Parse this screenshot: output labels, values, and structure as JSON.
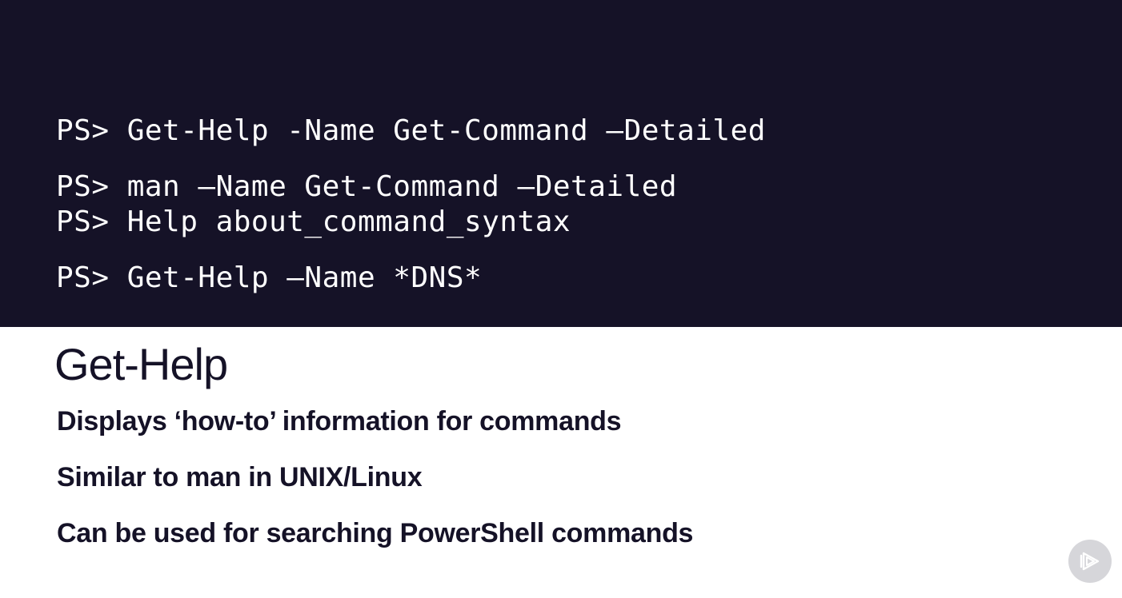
{
  "code": {
    "lines": [
      "PS> Get-Help -Name Get-Command –Detailed",
      "PS> man –Name Get-Command –Detailed",
      "PS> Help about_command_syntax",
      "PS> Get-Help –Name *DNS*"
    ]
  },
  "slide": {
    "title": "Get-Help",
    "bullets": [
      "Displays ‘how-to’ information for commands",
      "Similar to man in UNIX/Linux",
      "Can be used for searching PowerShell commands"
    ]
  },
  "colors": {
    "code_background": "#151227",
    "code_text": "#ffffff",
    "body_text": "#151227",
    "logo_background": "#d6d6da"
  },
  "icons": {
    "brand": "play-logo-icon"
  }
}
